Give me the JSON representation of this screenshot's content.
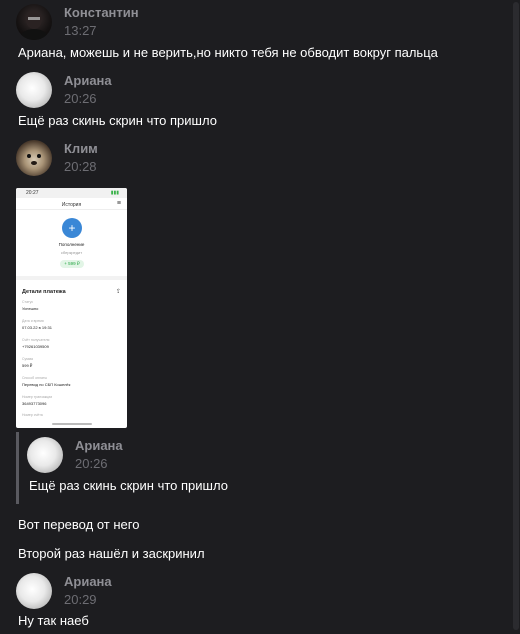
{
  "messages": [
    {
      "author": "Константин",
      "time": "13:27",
      "text": "Ариана, можешь и не верить,но никто тебя не обводит вокруг пальца",
      "avatar_icon": "user-avatar-dark-icon"
    },
    {
      "author": "Ариана",
      "time": "20:26",
      "text": "Ещё раз скинь скрин что пришло",
      "avatar_icon": "user-avatar-white-icon"
    },
    {
      "author": "Клим",
      "time": "20:28",
      "avatar_icon": "user-avatar-dog-icon"
    }
  ],
  "attachment": {
    "status_time": "20:27",
    "bar_title": "История",
    "recipient_name": "Пополнение",
    "recipient_sub": "сберкредит",
    "amount": "+ 599 ₽",
    "details_title": "Детали платежа",
    "rows": [
      {
        "label": "Статус",
        "value": "Успешно"
      },
      {
        "label": "Дата и время",
        "value": "07.03.22 в 19:31"
      },
      {
        "label": "Счёт получателя",
        "value": "+79261039509"
      },
      {
        "label": "Сумма",
        "value": "599 ₽"
      },
      {
        "label": "Способ оплаты",
        "value": "Перевод по СБП Кошелёк"
      },
      {
        "label": "Номер транзакции",
        "value": "36493773096"
      },
      {
        "label": "Номер счёта",
        "value": ""
      }
    ]
  },
  "reply": {
    "author": "Ариана",
    "time": "20:26",
    "text": "Ещё раз скинь скрин что пришло"
  },
  "followups": [
    "Вот перевод от него",
    "Второй раз нашёл и заскринил"
  ],
  "last": {
    "author": "Ариана",
    "time": "20:29",
    "text": "Ну так наеб"
  }
}
